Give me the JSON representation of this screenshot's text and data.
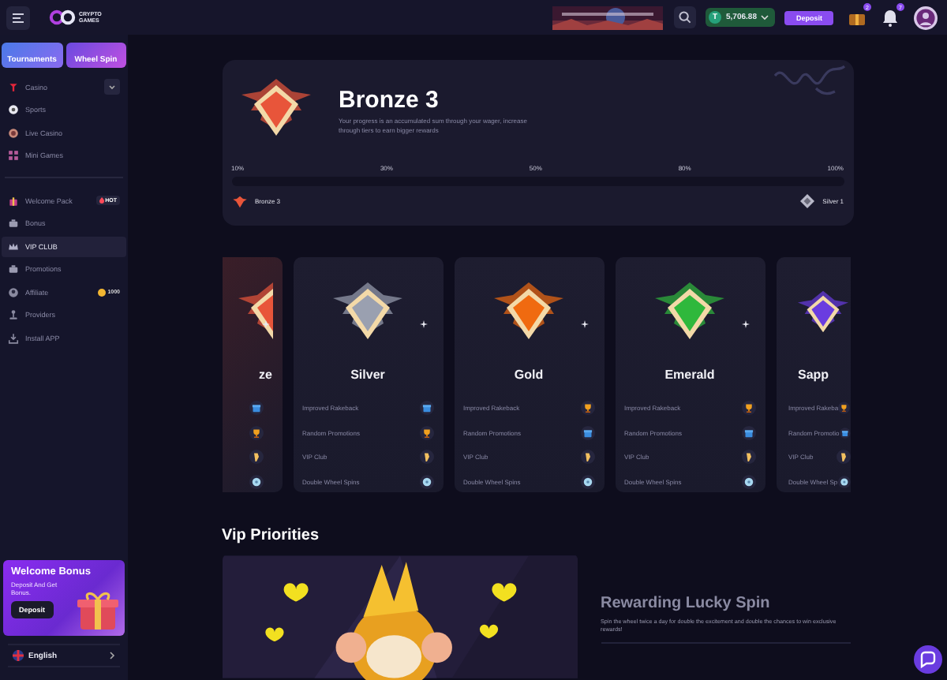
{
  "header": {
    "logo": {
      "line1": "CRYPTO",
      "line2": "GAMES"
    },
    "balance": {
      "currency": "T",
      "amount": "5,706.88"
    },
    "deposit": "Deposit",
    "gift_badge": "2",
    "bell_badge": "7"
  },
  "sidebar": {
    "promos": [
      {
        "label": "Tournaments"
      },
      {
        "label": "Wheel Spin"
      }
    ],
    "items": [
      {
        "label": "Casino",
        "kind": "casino",
        "selected": false,
        "expandable": true
      },
      {
        "label": "Sports",
        "kind": "ball",
        "selected": false
      },
      {
        "label": "Live Casino",
        "kind": "chip",
        "selected": false
      },
      {
        "label": "Mini Games",
        "kind": "grid",
        "selected": false
      },
      {
        "label": "Welcome Pack",
        "kind": "gift",
        "selected": false,
        "badge": "HOT",
        "section": true
      },
      {
        "label": "Bonus",
        "kind": "box",
        "selected": false
      },
      {
        "label": "VIP CLUB",
        "kind": "crown",
        "selected": true
      },
      {
        "label": "Promotions",
        "kind": "box",
        "selected": false
      },
      {
        "label": "Affiliate",
        "kind": "user",
        "selected": false,
        "coins": "1000"
      },
      {
        "label": "Providers",
        "kind": "joystick",
        "selected": false
      },
      {
        "label": "Install APP",
        "kind": "download",
        "selected": false
      }
    ],
    "bonus_card": {
      "title": "Welcome Bonus",
      "text": "Deposit And Get Bonus.",
      "button": "Deposit"
    },
    "language": "English"
  },
  "hero": {
    "title": "Bronze 3",
    "description": "Your progress is an accumulated sum through your wager, increase through tiers to earn bigger rewards",
    "ticks": [
      "10%",
      "30%",
      "50%",
      "80%",
      "100%"
    ],
    "level": 0,
    "current": "Bronze 3",
    "next": "Silver 1"
  },
  "tiers": [
    {
      "kind": "cut-left",
      "name": "ze",
      "color": "#e8553a",
      "perks": [
        {
          "kind": "box"
        },
        {
          "kind": "trophy"
        },
        {
          "kind": "hand"
        },
        {
          "kind": "wheel"
        }
      ]
    },
    {
      "kind": "full",
      "name": "Silver",
      "color": "#9aa0b0",
      "perks": [
        {
          "kind": "box",
          "text": "Improved Rakeback"
        },
        {
          "kind": "trophy",
          "text": "Random Promotions"
        },
        {
          "kind": "hand",
          "text": "VIP Club"
        },
        {
          "kind": "wheel",
          "text": "Double Wheel Spins"
        }
      ]
    },
    {
      "kind": "full",
      "name": "Gold",
      "color": "#f06a10",
      "perks": [
        {
          "kind": "trophy",
          "text": "Improved Rakeback"
        },
        {
          "kind": "box",
          "text": "Random Promotions"
        },
        {
          "kind": "hand",
          "text": "VIP Club"
        },
        {
          "kind": "wheel",
          "text": "Double Wheel Spins"
        }
      ]
    },
    {
      "kind": "full",
      "name": "Emerald",
      "color": "#2fb83c",
      "perks": [
        {
          "kind": "trophy",
          "text": "Improved Rakeback"
        },
        {
          "kind": "box",
          "text": "Random Promotions"
        },
        {
          "kind": "hand",
          "text": "VIP Club"
        },
        {
          "kind": "wheel",
          "text": "Double Wheel Spins"
        }
      ]
    },
    {
      "kind": "cut-right",
      "name": "Sapp",
      "color": "#6a3ce0",
      "perks": [
        {
          "kind": "trophy",
          "text": "Improved Rakeba"
        },
        {
          "kind": "box",
          "text": "Random Promotio"
        },
        {
          "kind": "hand",
          "text": "VIP Club"
        },
        {
          "kind": "wheel",
          "text": "Double Wheel Sp"
        }
      ]
    }
  ],
  "priorities": {
    "title": "Vip Priorities",
    "feature": {
      "title": "Rewarding Lucky Spin",
      "text": "Spin the wheel twice a day for double the excitement and double the chances to win exclusive rewards!"
    }
  }
}
